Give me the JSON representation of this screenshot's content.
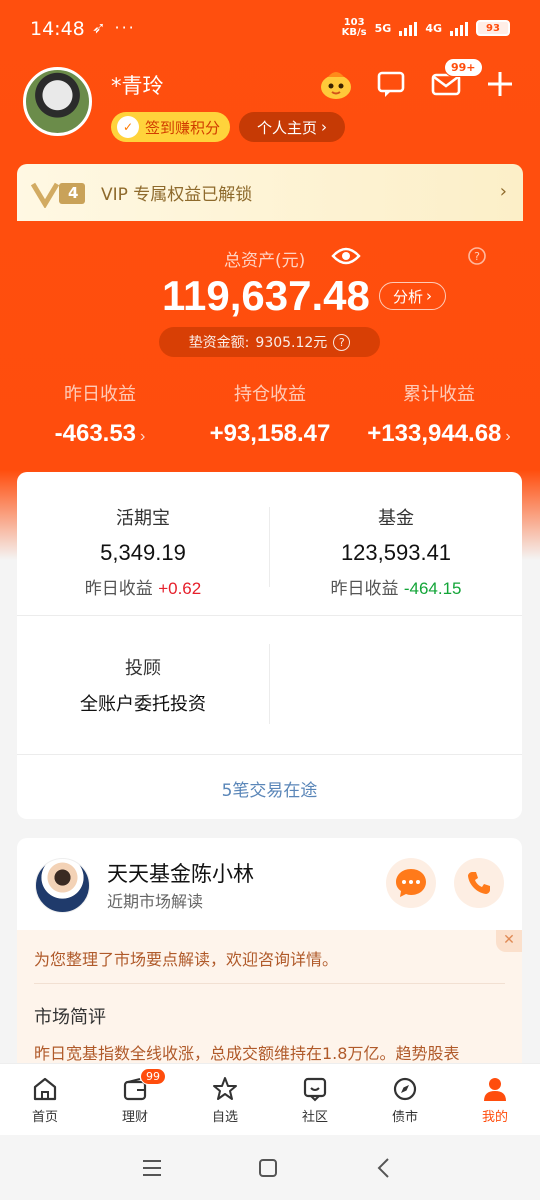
{
  "status": {
    "time": "14:48",
    "net_speed_top": "103",
    "net_speed_bottom": "KB/s",
    "net1": "5G",
    "net2": "4G",
    "battery": "93"
  },
  "profile": {
    "username": "*青玲",
    "sign_in_label": "签到赚积分",
    "home_label": "个人主页",
    "message_badge": "99+"
  },
  "vip": {
    "level": "4",
    "text": "VIP 专属权益已解锁"
  },
  "assets": {
    "label": "总资产(元)",
    "total": "119,637.48",
    "analyze_label": "分析",
    "advance_label": "垫资金额:",
    "advance_value": "9305.12元"
  },
  "earnings": [
    {
      "label": "昨日收益",
      "value": "-463.53"
    },
    {
      "label": "持仓收益",
      "value": "+93,158.47"
    },
    {
      "label": "累计收益",
      "value": "+133,944.68"
    }
  ],
  "products": {
    "huoqibao": {
      "title": "活期宝",
      "value": "5,349.19",
      "sub_label": "昨日收益",
      "sub_value": "+0.62"
    },
    "fund": {
      "title": "基金",
      "value": "123,593.41",
      "sub_label": "昨日收益",
      "sub_value": "-464.15"
    },
    "advisor": {
      "title": "投顾",
      "value": "全账户委托投资"
    },
    "in_transit": "5笔交易在途"
  },
  "advisor_card": {
    "name": "天天基金陈小林",
    "subtitle": "近期市场解读",
    "notice": "为您整理了市场要点解读，欢迎咨询详情。",
    "market_title": "市场简评",
    "market_text": "昨日宽基指数全线收涨，总成交额维持在1.8万亿。趋势股表"
  },
  "tabs": [
    {
      "label": "首页",
      "icon": "home-icon"
    },
    {
      "label": "理财",
      "icon": "wallet-icon",
      "badge": "99"
    },
    {
      "label": "自选",
      "icon": "star-icon"
    },
    {
      "label": "社区",
      "icon": "community-icon"
    },
    {
      "label": "债市",
      "icon": "compass-icon"
    },
    {
      "label": "我的",
      "icon": "person-icon",
      "active": true
    }
  ],
  "colors": {
    "brand": "#ff4d0d",
    "up": "#e6202b",
    "down": "#13a538",
    "link": "#5a86b8"
  }
}
